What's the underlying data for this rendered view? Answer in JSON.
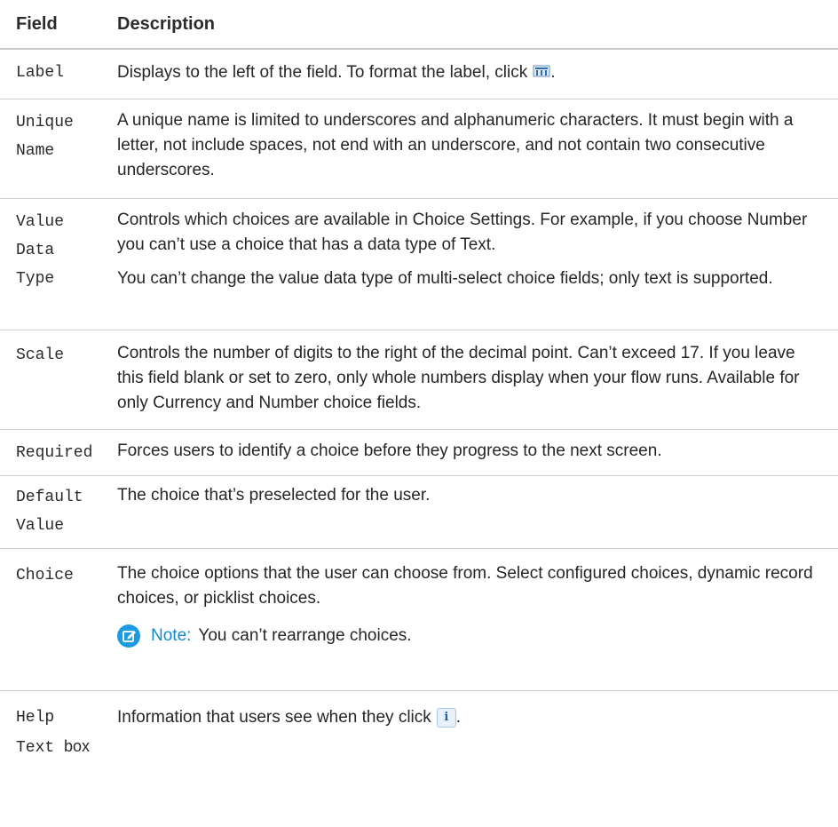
{
  "header": {
    "field": "Field",
    "description": "Description"
  },
  "rows": [
    {
      "field_lines": [
        "Label"
      ],
      "paragraphs": [
        "Displays to the left of the field. To format the label, click",
        "."
      ],
      "icon": "format-columns-icon"
    },
    {
      "field_lines": [
        "Unique",
        "Name"
      ],
      "paragraphs": [
        "A unique name is limited to underscores and alphanumeric characters. It must begin with a letter, not include spaces, not end with an underscore, and not contain two consecutive underscores."
      ]
    },
    {
      "field_lines": [
        "Value",
        "Data",
        "Type"
      ],
      "paragraphs": [
        "Controls which choices are available in Choice Settings. For example, if you choose Number you can’t use a choice that has a data type of Text.",
        "You can’t change the value data type of multi-select choice fields; only text is supported."
      ]
    },
    {
      "field_lines": [
        "Scale"
      ],
      "paragraphs": [
        "Controls the number of digits to the right of the decimal point. Can’t exceed 17. If you leave this field blank or set to zero, only whole numbers display when your flow runs. Available for only Currency and Number choice fields."
      ]
    },
    {
      "field_lines": [
        "Required"
      ],
      "paragraphs": [
        "Forces users to identify a choice before they progress to the next screen."
      ]
    },
    {
      "field_lines": [
        "Default",
        "Value"
      ],
      "paragraphs": [
        "The choice that’s preselected for the user."
      ]
    },
    {
      "field_lines": [
        "Choice"
      ],
      "paragraphs": [
        "The choice options that the user can choose from. Select configured choices, dynamic record choices, or picklist choices."
      ],
      "note": {
        "label": "Note:",
        "text": "You can’t rearrange choices.",
        "icon": "note-pencil-icon"
      }
    },
    {
      "field_lines": [
        "Help",
        "Text"
      ],
      "field_suffix": "box",
      "paragraphs": [
        "Information that users see when they click",
        "."
      ],
      "icon": "info-icon",
      "icon_text": "i"
    }
  ],
  "colors": {
    "note_accent": "#1589c9",
    "divider": "#cfcfcf"
  }
}
